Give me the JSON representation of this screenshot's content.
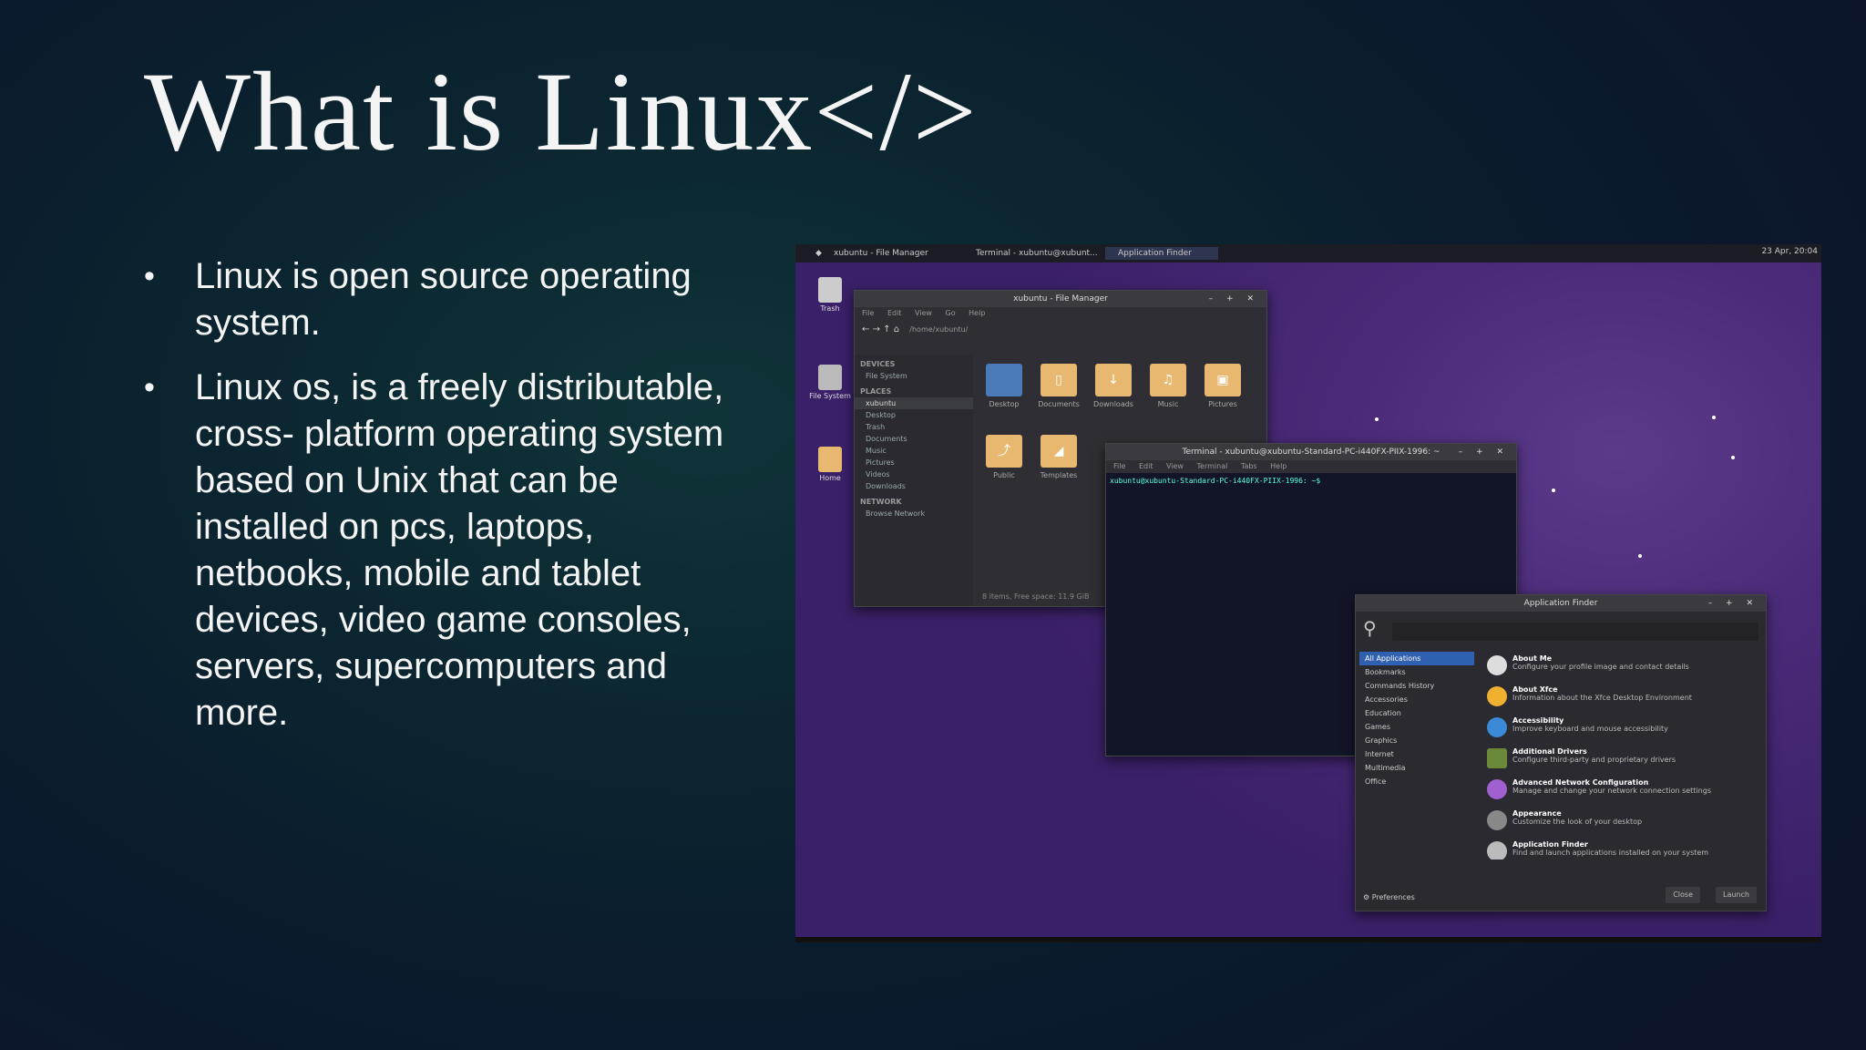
{
  "slide": {
    "title": "What is Linux</>",
    "bullets": [
      "Linux is open source operating system.",
      "Linux os, is a freely distributable, cross- platform operating system based on Unix that  can be installed on pcs, laptops, netbooks, mobile and tablet devices, video game  consoles, servers, supercomputers and more."
    ],
    "bullet_glyph": "•"
  },
  "screenshot": {
    "panel": {
      "tasks": [
        "xubuntu - File Manager",
        "Terminal - xubuntu@xubunt...",
        "Application Finder"
      ],
      "clock": "23 Apr, 20:04"
    },
    "desktop_icons": [
      "Trash",
      "File System",
      "Home"
    ],
    "file_manager": {
      "title": "xubuntu - File Manager",
      "menu": [
        "File",
        "Edit",
        "View",
        "Go",
        "Help"
      ],
      "path": "/home/xubuntu/",
      "sections": [
        {
          "header": "DEVICES",
          "items": [
            "File System"
          ]
        },
        {
          "header": "PLACES",
          "items": [
            "xubuntu",
            "Desktop",
            "Trash",
            "Documents",
            "Music",
            "Pictures",
            "Videos",
            "Downloads"
          ]
        },
        {
          "header": "NETWORK",
          "items": [
            "Browse Network"
          ]
        }
      ],
      "folders": [
        "Desktop",
        "Documents",
        "Downloads",
        "Music",
        "Pictures",
        "Public",
        "Templates"
      ],
      "status": "8 items, Free space: 11.9 GiB"
    },
    "terminal": {
      "title": "Terminal - xubuntu@xubuntu-Standard-PC-i440FX-PIIX-1996: ~",
      "menu": [
        "File",
        "Edit",
        "View",
        "Terminal",
        "Tabs",
        "Help"
      ],
      "prompt": "xubuntu@xubuntu-Standard-PC-i440FX-PIIX-1996: ~$"
    },
    "app_finder": {
      "title": "Application Finder",
      "categories": [
        "All Applications",
        "Bookmarks",
        "Commands History",
        "Accessories",
        "Education",
        "Games",
        "Graphics",
        "Internet",
        "Multimedia",
        "Office"
      ],
      "apps": [
        {
          "name": "About Me",
          "desc": "Configure your profile image and contact details"
        },
        {
          "name": "About Xfce",
          "desc": "Information about the Xfce Desktop Environment"
        },
        {
          "name": "Accessibility",
          "desc": "Improve keyboard and mouse accessibility"
        },
        {
          "name": "Additional Drivers",
          "desc": "Configure third-party and proprietary drivers"
        },
        {
          "name": "Advanced Network Configuration",
          "desc": "Manage and change your network connection settings"
        },
        {
          "name": "Appearance",
          "desc": "Customize the look of your desktop"
        },
        {
          "name": "Application Finder",
          "desc": "Find and launch applications installed on your system"
        }
      ],
      "preferences": "Preferences",
      "close": "Close",
      "launch": "Launch"
    },
    "colors": {
      "selection": "#3060b0",
      "folder": "#e8b870",
      "prompt": "#55ddcc"
    }
  }
}
